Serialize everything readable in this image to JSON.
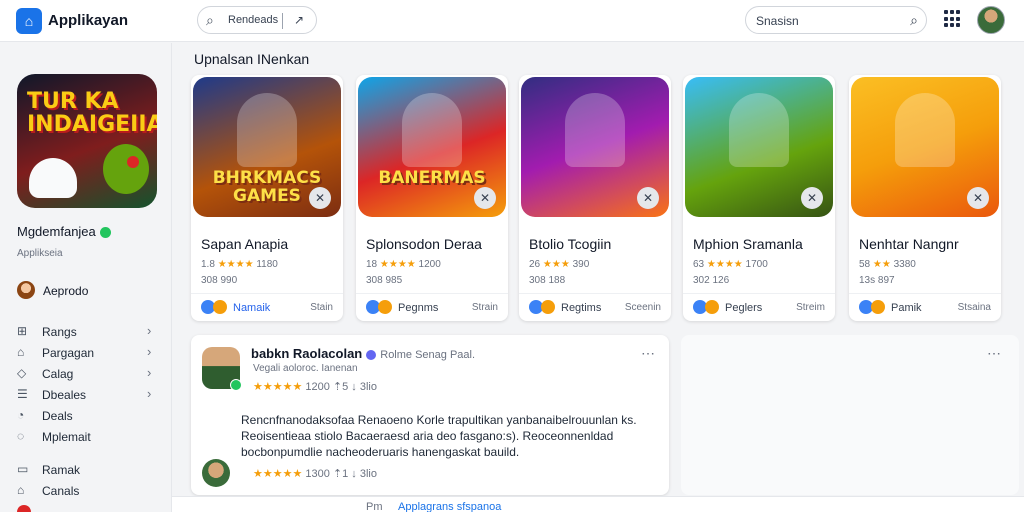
{
  "app": {
    "title": "Applikayan",
    "logo_glyph": "⌂"
  },
  "header": {
    "search": {
      "label": "Rendeads",
      "arrow": "↗"
    },
    "search2": {
      "placeholder": "Snasisn"
    }
  },
  "sidebar": {
    "feature_title": "TUR KA INDAIGEIIA",
    "feature_name": "Mgdemfanjea",
    "feature_sub": "Applikseia",
    "user_label": "Aeprodo",
    "nav": [
      {
        "label": "Rangs",
        "icon": "grid-icon"
      },
      {
        "label": "Pargagan",
        "icon": "home-icon"
      },
      {
        "label": "Calag",
        "icon": "tag-icon"
      },
      {
        "label": "Dbeales",
        "icon": "list-icon"
      },
      {
        "label": "Deals",
        "icon": "bell-icon"
      },
      {
        "label": "Mplemait",
        "icon": "chat-icon"
      }
    ],
    "nav2": [
      {
        "label": "Ramak",
        "icon": "doc-icon"
      },
      {
        "label": "Canals",
        "icon": "user-icon"
      }
    ]
  },
  "main": {
    "section_title": "Upnalsan INenkan",
    "cards": [
      {
        "banner": "BHRKMACS GAMES",
        "name": "Sapan Anapia",
        "rating": "★★★★",
        "rating_pre": "1.8",
        "rating_post": "1180",
        "count": "308 990",
        "foot_left": "Namaik",
        "foot_right": "Stain",
        "foot_left_color": "#2563eb",
        "bg": "linear-gradient(160deg,#1e3a8a 0%,#b45309 60%,#7c2d12 100%)"
      },
      {
        "banner": "BANERMAS",
        "name": "Splonsodon Deraa",
        "rating": "★★★★",
        "rating_pre": "18",
        "rating_post": "1200",
        "count": "308 985",
        "foot_left": "Pegnms",
        "foot_right": "Strain",
        "foot_left_color": "#374151",
        "bg": "linear-gradient(160deg,#0ea5e9 0%,#dc2626 55%,#f59e0b 100%)"
      },
      {
        "banner": "",
        "name": "Btolio Tcogiin",
        "rating": "★★★",
        "rating_pre": "26",
        "rating_post": "390",
        "count": "308 188",
        "foot_left": "Regtims",
        "foot_right": "Sceenin",
        "foot_left_color": "#374151",
        "bg": "linear-gradient(160deg,#312e81 0%,#a21caf 50%,#f97316 100%)"
      },
      {
        "banner": "",
        "name": "Mphion Sramanla",
        "rating": "★★★★",
        "rating_pre": "63",
        "rating_post": "1700",
        "count": "302 126",
        "foot_left": "Peglers",
        "foot_right": "Streim",
        "foot_left_color": "#374151",
        "bg": "linear-gradient(160deg,#38bdf8 0%,#65a30d 60%,#365314 100%)"
      },
      {
        "banner": "",
        "name": "Nenhtar Nangnr",
        "rating": "★★",
        "rating_pre": "58",
        "rating_post": "3380",
        "count": "13s 897",
        "foot_left": "Pamik",
        "foot_right": "Stsaina",
        "foot_left_color": "#374151",
        "bg": "linear-gradient(160deg,#fbbf24 0%,#f59e0b 50%,#ea580c 100%)"
      }
    ]
  },
  "review": {
    "name": "babkn Raolacolan",
    "meta": "Rolme Senag Paal.",
    "sub": "Vegali aoloroc. Ianenan",
    "stars": "★★★★★",
    "stats": "1200  ⇡5  ↓ 3lio",
    "body": "Rencnfnanodaksofaa Renaoeno Korle trapultikan yanbanaibelrouunlan ks. Reoisentieaa stiolo Bacaeraesd aria deo fasgano:s). Reoceonnenldad bocbonpumdlie nacheoderuaris hanengaskat bauild.",
    "stars2": "★★★★★",
    "stats2": "1300  ⇡1  ↓ 3lio"
  },
  "bottom": {
    "a": "Pm",
    "b": "Applagrans sfspanoa"
  }
}
